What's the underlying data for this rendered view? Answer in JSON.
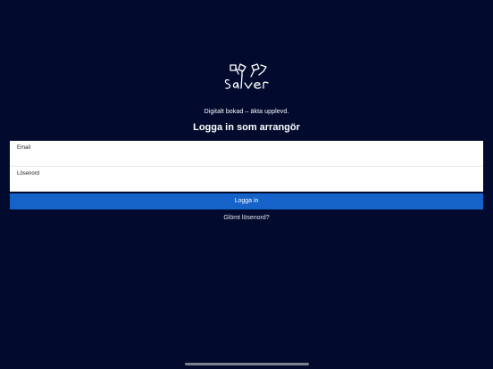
{
  "brand": {
    "logo_icon": "salver-logo-icon",
    "tagline": "Digitalt bokad – äkta upplevd."
  },
  "login": {
    "title": "Logga in som arrangör",
    "email_label": "Email",
    "email_value": "",
    "password_label": "Lösenord",
    "password_value": "",
    "submit_label": "Logga in",
    "forgot_label": "Glömt lösenord?"
  },
  "colors": {
    "background": "#020b2e",
    "primary_button": "#1562c9",
    "card": "#ffffff"
  }
}
